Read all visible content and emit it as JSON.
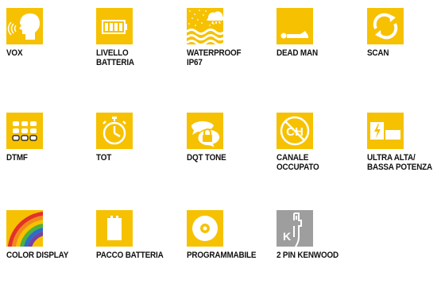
{
  "colors": {
    "tile_yellow": "#f6c100",
    "tile_gray": "#9e9e9e",
    "ink": "#111111"
  },
  "features": [
    {
      "label": "VOX",
      "icon": "vox-head-icon"
    },
    {
      "label": "LIVELLO BATTERIA",
      "icon": "battery-level-icon"
    },
    {
      "label": "WATERPROOF\nIP67",
      "icon": "waterproof-icon"
    },
    {
      "label": "DEAD MAN",
      "icon": "dead-man-icon"
    },
    {
      "label": "SCAN",
      "icon": "scan-icon"
    },
    {
      "label": "DTMF",
      "icon": "dtmf-keypad-icon"
    },
    {
      "label": "TOT",
      "icon": "stopwatch-icon"
    },
    {
      "label": "DQT TONE",
      "icon": "dqt-tone-icon"
    },
    {
      "label": "CANALE OCCUPATO",
      "icon": "busy-channel-icon",
      "icon_text": "CH"
    },
    {
      "label": "ULTRA ALTA/\nBASSA POTENZA",
      "icon": "power-level-icon"
    },
    {
      "label": "COLOR DISPLAY",
      "icon": "color-display-icon"
    },
    {
      "label": "PACCO BATTERIA",
      "icon": "battery-pack-icon"
    },
    {
      "label": "PROGRAMMABILE",
      "icon": "programmable-disc-icon"
    },
    {
      "label": "2 PIN KENWOOD",
      "icon": "kenwood-connector-icon",
      "icon_text": "K"
    }
  ]
}
